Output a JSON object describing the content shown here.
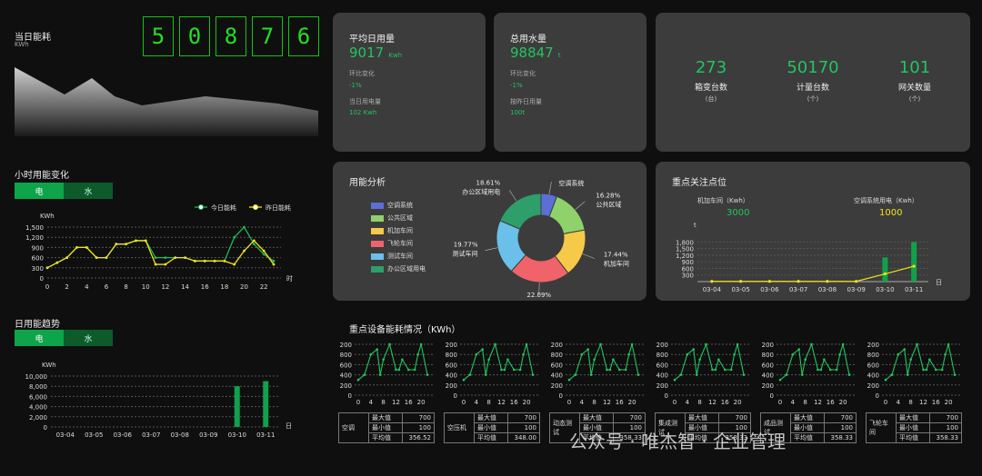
{
  "today": {
    "title": "当日能耗",
    "unit": "KWh",
    "digits": [
      "5",
      "0",
      "8",
      "7",
      "6"
    ]
  },
  "hourly": {
    "title": "小时用能变化",
    "tabs": [
      "电",
      "水"
    ],
    "unit": "KWh",
    "x_unit": "时",
    "legend": [
      "今日能耗",
      "昨日能耗"
    ],
    "yticks": [
      "1,500",
      "1,200",
      "900",
      "600",
      "300",
      "0"
    ],
    "xticks": [
      "0",
      "2",
      "4",
      "6",
      "8",
      "10",
      "12",
      "14",
      "16",
      "18",
      "20",
      "22"
    ]
  },
  "daily": {
    "title": "日用能趋势",
    "tabs": [
      "电",
      "水"
    ],
    "unit": "KWh",
    "x_unit": "日",
    "yticks": [
      "10,000",
      "8,000",
      "6,000",
      "4,000",
      "2,000",
      "0"
    ],
    "xticks": [
      "03-04",
      "03-05",
      "03-06",
      "03-07",
      "03-08",
      "03-09",
      "03-10",
      "03-11"
    ]
  },
  "avg_daily": {
    "title": "平均日用量",
    "value": "9017",
    "unit": "Kwh",
    "mom_label": "环比变化",
    "mom_value": "-1%",
    "today_label": "当日用电量",
    "today_value": "102 Kwh"
  },
  "water": {
    "title": "总用水量",
    "value": "98847",
    "unit": "t",
    "mom_label": "环比变化",
    "mom_value": "-1%",
    "today_label": "按昨日用量",
    "today_value": "100t"
  },
  "stats": [
    {
      "value": "273",
      "label": "箱变台数",
      "unit": "(台)"
    },
    {
      "value": "50170",
      "label": "计量台数",
      "unit": "(个)"
    },
    {
      "value": "101",
      "label": "网关数量",
      "unit": "(个)"
    }
  ],
  "usage": {
    "title": "用能分析",
    "legend": [
      "空调系统",
      "公共区域",
      "机加车间",
      "飞轮车间",
      "测试车间",
      "办公区域用电"
    ],
    "colors": [
      "#5b6fd6",
      "#8fd16a",
      "#f7c948",
      "#f0636b",
      "#6ac0e8",
      "#2e9e6a"
    ],
    "slices": [
      {
        "name": "空调系统",
        "pct": "5.81%"
      },
      {
        "name": "公共区域",
        "pct": "16.28%"
      },
      {
        "name": "机加车间",
        "pct": "17.44%"
      },
      {
        "name": "飞轮车间",
        "pct": "22.09%"
      },
      {
        "name": "测试车间",
        "pct": "19.77%"
      },
      {
        "name": "办公区域用电",
        "pct": "18.61%"
      }
    ]
  },
  "focus": {
    "title": "重点关注点位",
    "item1_label": "机加车间（Kwh）",
    "item1_value": "3000",
    "item2_label": "空调系统用电（Kwh）",
    "item2_value": "1000",
    "unit": "t",
    "x_unit": "日",
    "yticks": [
      "1,800",
      "1,500",
      "1,200",
      "900",
      "600",
      "300"
    ],
    "xticks": [
      "03-04",
      "03-05",
      "03-06",
      "03-07",
      "03-08",
      "03-09",
      "03-10",
      "03-11"
    ]
  },
  "equip": {
    "title": "重点设备能耗情况（KWh）",
    "yticks": [
      "200",
      "800",
      "600",
      "400",
      "200",
      "0"
    ],
    "xticks": [
      "0",
      "4",
      "8",
      "12",
      "16",
      "20"
    ],
    "row_labels": [
      "最大值",
      "最小值",
      "平均值"
    ],
    "devices": [
      {
        "name": "空调",
        "max": "700",
        "min": "100",
        "avg": "356.52"
      },
      {
        "name": "空压机",
        "max": "700",
        "min": "100",
        "avg": "348.00"
      },
      {
        "name": "动态测试",
        "max": "700",
        "min": "100",
        "avg": "358.33"
      },
      {
        "name": "集成测试",
        "max": "700",
        "min": "100",
        "avg": "358.33"
      },
      {
        "name": "成品测试",
        "max": "700",
        "min": "100",
        "avg": "358.33"
      },
      {
        "name": "飞轮车间",
        "max": "700",
        "min": "100",
        "avg": "358.33"
      }
    ]
  },
  "watermark": "公众号 · 唯杰智 · 企业管理",
  "chart_data": [
    {
      "type": "line",
      "title": "小时用能变化",
      "ylabel": "KWh",
      "xlabel": "时",
      "ylim": [
        0,
        1500
      ],
      "x": [
        0,
        1,
        2,
        3,
        4,
        5,
        6,
        7,
        8,
        9,
        10,
        11,
        12,
        13,
        14,
        15,
        16,
        17,
        18,
        19,
        20,
        21,
        22,
        23
      ],
      "series": [
        {
          "name": "今日能耗",
          "values": [
            300,
            450,
            600,
            900,
            900,
            600,
            600,
            1000,
            1000,
            1100,
            1100,
            600,
            600,
            600,
            600,
            500,
            500,
            500,
            500,
            1200,
            1500,
            1000,
            700,
            500
          ]
        },
        {
          "name": "昨日能耗",
          "values": [
            300,
            450,
            600,
            900,
            900,
            600,
            600,
            1000,
            1000,
            1100,
            1100,
            400,
            400,
            600,
            600,
            500,
            500,
            500,
            500,
            400,
            800,
            1100,
            800,
            400
          ]
        }
      ]
    },
    {
      "type": "bar",
      "title": "日用能趋势",
      "ylabel": "KWh",
      "xlabel": "日",
      "ylim": [
        0,
        10000
      ],
      "categories": [
        "03-04",
        "03-05",
        "03-06",
        "03-07",
        "03-08",
        "03-09",
        "03-10",
        "03-11"
      ],
      "values": [
        0,
        0,
        0,
        0,
        0,
        0,
        8000,
        9000
      ]
    },
    {
      "type": "pie",
      "title": "用能分析",
      "categories": [
        "空调系统",
        "公共区域",
        "机加车间",
        "飞轮车间",
        "测试车间",
        "办公区域用电"
      ],
      "values": [
        5.81,
        16.28,
        17.44,
        22.09,
        19.77,
        18.61
      ]
    },
    {
      "type": "bar",
      "title": "重点关注点位",
      "ylabel": "t",
      "xlabel": "日",
      "ylim": [
        0,
        1900
      ],
      "categories": [
        "03-04",
        "03-05",
        "03-06",
        "03-07",
        "03-08",
        "03-09",
        "03-10",
        "03-11"
      ],
      "series": [
        {
          "name": "机加车间",
          "values": [
            0,
            0,
            0,
            0,
            0,
            0,
            1100,
            1800
          ]
        },
        {
          "name": "空调系统用电",
          "values": [
            10,
            10,
            10,
            10,
            10,
            10,
            350,
            700
          ]
        }
      ]
    },
    {
      "type": "line",
      "title": "重点设备能耗情况（KWh）",
      "ylim": [
        0,
        1000
      ],
      "x": [
        0,
        2,
        4,
        6,
        7,
        8,
        10,
        12,
        13,
        14,
        16,
        18,
        19,
        20,
        22
      ],
      "values": [
        300,
        400,
        800,
        900,
        400,
        700,
        1000,
        500,
        500,
        700,
        500,
        500,
        800,
        1000,
        400
      ]
    }
  ]
}
